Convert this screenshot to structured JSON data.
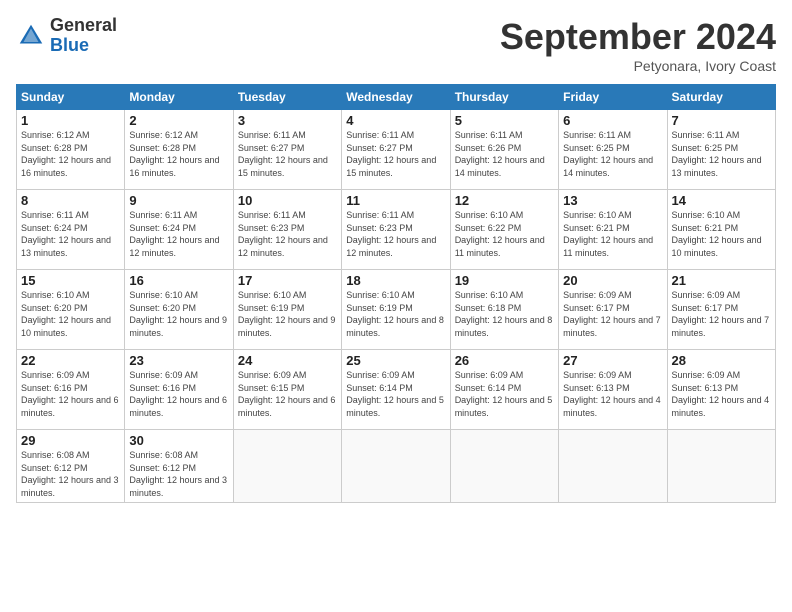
{
  "logo": {
    "general": "General",
    "blue": "Blue"
  },
  "title": "September 2024",
  "location": "Petyonara, Ivory Coast",
  "days_of_week": [
    "Sunday",
    "Monday",
    "Tuesday",
    "Wednesday",
    "Thursday",
    "Friday",
    "Saturday"
  ],
  "weeks": [
    [
      {
        "day": "1",
        "sunrise": "6:12 AM",
        "sunset": "6:28 PM",
        "daylight": "12 hours and 16 minutes."
      },
      {
        "day": "2",
        "sunrise": "6:12 AM",
        "sunset": "6:28 PM",
        "daylight": "12 hours and 16 minutes."
      },
      {
        "day": "3",
        "sunrise": "6:11 AM",
        "sunset": "6:27 PM",
        "daylight": "12 hours and 15 minutes."
      },
      {
        "day": "4",
        "sunrise": "6:11 AM",
        "sunset": "6:27 PM",
        "daylight": "12 hours and 15 minutes."
      },
      {
        "day": "5",
        "sunrise": "6:11 AM",
        "sunset": "6:26 PM",
        "daylight": "12 hours and 14 minutes."
      },
      {
        "day": "6",
        "sunrise": "6:11 AM",
        "sunset": "6:25 PM",
        "daylight": "12 hours and 14 minutes."
      },
      {
        "day": "7",
        "sunrise": "6:11 AM",
        "sunset": "6:25 PM",
        "daylight": "12 hours and 13 minutes."
      }
    ],
    [
      {
        "day": "8",
        "sunrise": "6:11 AM",
        "sunset": "6:24 PM",
        "daylight": "12 hours and 13 minutes."
      },
      {
        "day": "9",
        "sunrise": "6:11 AM",
        "sunset": "6:24 PM",
        "daylight": "12 hours and 12 minutes."
      },
      {
        "day": "10",
        "sunrise": "6:11 AM",
        "sunset": "6:23 PM",
        "daylight": "12 hours and 12 minutes."
      },
      {
        "day": "11",
        "sunrise": "6:11 AM",
        "sunset": "6:23 PM",
        "daylight": "12 hours and 12 minutes."
      },
      {
        "day": "12",
        "sunrise": "6:10 AM",
        "sunset": "6:22 PM",
        "daylight": "12 hours and 11 minutes."
      },
      {
        "day": "13",
        "sunrise": "6:10 AM",
        "sunset": "6:21 PM",
        "daylight": "12 hours and 11 minutes."
      },
      {
        "day": "14",
        "sunrise": "6:10 AM",
        "sunset": "6:21 PM",
        "daylight": "12 hours and 10 minutes."
      }
    ],
    [
      {
        "day": "15",
        "sunrise": "6:10 AM",
        "sunset": "6:20 PM",
        "daylight": "12 hours and 10 minutes."
      },
      {
        "day": "16",
        "sunrise": "6:10 AM",
        "sunset": "6:20 PM",
        "daylight": "12 hours and 9 minutes."
      },
      {
        "day": "17",
        "sunrise": "6:10 AM",
        "sunset": "6:19 PM",
        "daylight": "12 hours and 9 minutes."
      },
      {
        "day": "18",
        "sunrise": "6:10 AM",
        "sunset": "6:19 PM",
        "daylight": "12 hours and 8 minutes."
      },
      {
        "day": "19",
        "sunrise": "6:10 AM",
        "sunset": "6:18 PM",
        "daylight": "12 hours and 8 minutes."
      },
      {
        "day": "20",
        "sunrise": "6:09 AM",
        "sunset": "6:17 PM",
        "daylight": "12 hours and 7 minutes."
      },
      {
        "day": "21",
        "sunrise": "6:09 AM",
        "sunset": "6:17 PM",
        "daylight": "12 hours and 7 minutes."
      }
    ],
    [
      {
        "day": "22",
        "sunrise": "6:09 AM",
        "sunset": "6:16 PM",
        "daylight": "12 hours and 6 minutes."
      },
      {
        "day": "23",
        "sunrise": "6:09 AM",
        "sunset": "6:16 PM",
        "daylight": "12 hours and 6 minutes."
      },
      {
        "day": "24",
        "sunrise": "6:09 AM",
        "sunset": "6:15 PM",
        "daylight": "12 hours and 6 minutes."
      },
      {
        "day": "25",
        "sunrise": "6:09 AM",
        "sunset": "6:14 PM",
        "daylight": "12 hours and 5 minutes."
      },
      {
        "day": "26",
        "sunrise": "6:09 AM",
        "sunset": "6:14 PM",
        "daylight": "12 hours and 5 minutes."
      },
      {
        "day": "27",
        "sunrise": "6:09 AM",
        "sunset": "6:13 PM",
        "daylight": "12 hours and 4 minutes."
      },
      {
        "day": "28",
        "sunrise": "6:09 AM",
        "sunset": "6:13 PM",
        "daylight": "12 hours and 4 minutes."
      }
    ],
    [
      {
        "day": "29",
        "sunrise": "6:08 AM",
        "sunset": "6:12 PM",
        "daylight": "12 hours and 3 minutes."
      },
      {
        "day": "30",
        "sunrise": "6:08 AM",
        "sunset": "6:12 PM",
        "daylight": "12 hours and 3 minutes."
      },
      null,
      null,
      null,
      null,
      null
    ]
  ]
}
